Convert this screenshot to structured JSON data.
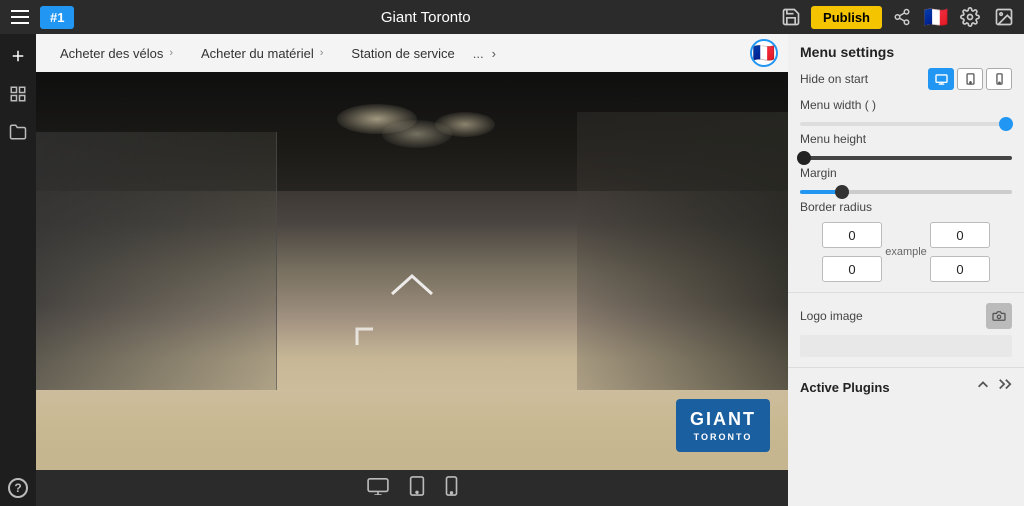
{
  "topbar": {
    "tab1": "#1",
    "title": "Giant Toronto",
    "publish_label": "Publish",
    "flag_emoji": "🇫🇷"
  },
  "nav": {
    "item1": "Acheter des vélos",
    "item2": "Acheter du matériel",
    "item3": "Station de service",
    "dots": "...",
    "chevron": "›"
  },
  "giant_logo": {
    "main": "GIANT",
    "sub": "TORONTO"
  },
  "right_panel": {
    "title": "Menu settings",
    "hide_on_start_label": "Hide on start",
    "menu_width_label": "Menu width ( )",
    "menu_height_label": "Menu height",
    "margin_label": "Margin",
    "border_radius_label": "Border radius",
    "border_radius_tl": "0",
    "border_radius_tr": "0",
    "border_radius_bl": "0",
    "border_radius_br": "0",
    "border_radius_example": "example",
    "logo_image_label": "Logo image",
    "active_plugins_label": "Active Plugins"
  },
  "sliders": {
    "menu_width_percent": 97,
    "menu_height_percent": 2,
    "margin_percent": 20
  },
  "bottom_toolbar": {
    "desktop_icon": "🖥",
    "tablet_icon": "⬜",
    "mobile_icon": "📱"
  },
  "help": {
    "icon": "?"
  }
}
